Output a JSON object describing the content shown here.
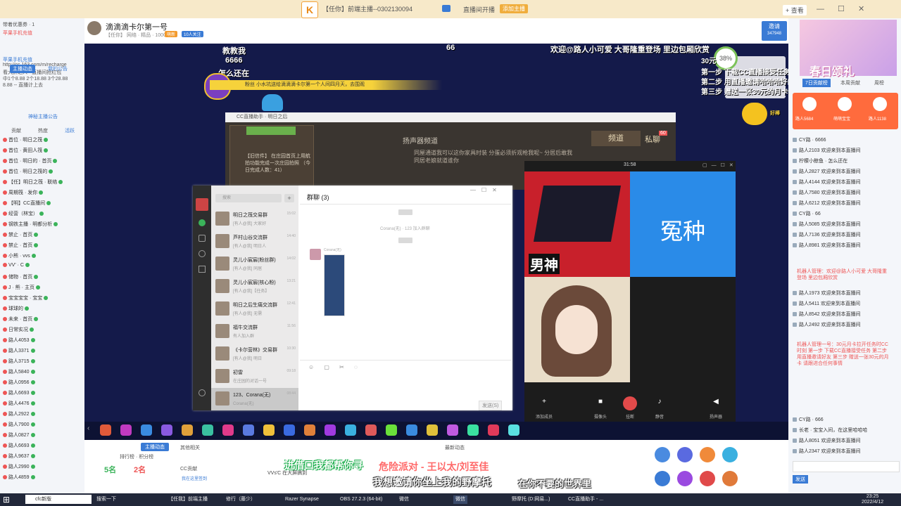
{
  "topbar": {
    "logo": "K",
    "title": "【任你】前端主播--0302130094",
    "live_label": "直播间开播",
    "add_button": "添加主播",
    "user_button": "+ 查看",
    "window_controls": "— ☐ ✕"
  },
  "left_panel": {
    "lines": [
      "带着优惠券 · 1",
      "苹果手机充值",
      "http://cc.163.com/m/recharge",
      "看大屏达人 · 直播间抢红包",
      "中1个8.88 2个18.88 3个28.88",
      "8.88 -- 直播计上去"
    ],
    "tabs": [
      "主播动态",
      "我的公告"
    ],
    "subtab": "神秘主播公告",
    "list_tabs": [
      "贡献",
      "热度",
      "活跃"
    ],
    "rows": [
      "首位 · 明日之筏",
      "首位 · 黄田人筏",
      "首位 · 明日的 · 首页",
      "首位 · 明日之筏的",
      "【任】明日之筏 · 联络",
      "周期筏 · 发你",
      "【明】CC直播间",
      "经营（林宝）",
      "钢铁主播 · 明都分析",
      "禁止 · 首页",
      "禁止 · 首页",
      "小熊 · vvs",
      "VV' · C",
      "储物 · 首页",
      "J · 熊 · 主页",
      "宝宝宝宝 · 宝宝",
      "球球的",
      "未来 · 首页",
      "日常实况",
      "路人4053",
      "路人3371",
      "路人3715",
      "路人5840",
      "路人0956",
      "路人6693",
      "路人4476",
      "路人2922",
      "路人7900",
      "路人0827",
      "路人6693",
      "路人9637",
      "路人2990",
      "路人4859"
    ]
  },
  "streamer": {
    "name": "滴滴滴卡尔第一号",
    "sub": "【任你】 网络 · 精品 · 1000人",
    "tag1": "萌新",
    "tag2": "10人关注",
    "share_label": "邀请",
    "share_count": "347948"
  },
  "overlay": {
    "left_lines": [
      "教教我",
      "6666",
      "怎么还在"
    ],
    "center_number": "66",
    "welcome": "欢迎@路人小可爱 大哥隆重登场 里边包厢欣赏",
    "banner": "粉丝  小水坑送给滴滴滴卡尔第一个人间四月天，去围观",
    "timer": "38%",
    "steps": [
      "30元",
      "第一步 下载CC直播接受任务",
      "第二步 用直播邀请哈哈哈好的",
      "第三步 赠送一张30元的月卡"
    ],
    "crown_label": "好棒",
    "gift_badge": "60"
  },
  "game": {
    "title": "CC直播助手 · 明日之后",
    "channel": "扬声器频道",
    "tab_channel": "频道",
    "tab_private": "私聊",
    "message": "同屋通道我可以这你家具时装 分蛋必须折观枪我呢~ 分居后敢我同居老娘就道谁你",
    "info": "【旧信件】 在庄园首页上用航拍功能完成一次庄园拍照 （今日完成人数：41）"
  },
  "wechat": {
    "search_placeholder": "搜索",
    "plus": "+",
    "chat_title": "群聊 (3)",
    "system_msg": "Corana(无) · 123 加入群聊",
    "sender": "Corana(无)",
    "tools": "☺ ▢ ✂ ◌",
    "send_label": "发送(S)",
    "contacts": [
      {
        "name": "明日之筏交易群",
        "preview": "[有人@我] 大家好",
        "time": "15:02"
      },
      {
        "name": "芦村山谷交流群",
        "preview": "[有人@我] 明日人",
        "time": "14:40"
      },
      {
        "name": "灵儿小宸宸(粉丝群)",
        "preview": "[有人@我] 同居",
        "time": "14:02"
      },
      {
        "name": "灵儿小宸宸(核心粉)",
        "preview": "[有人@我]【任务】",
        "time": "13:21"
      },
      {
        "name": "明日之后生痛交流群",
        "preview": "[有人@我] 无需",
        "time": "12:41"
      },
      {
        "name": "福牛交流群",
        "preview": "有人加入群",
        "time": "11:56"
      },
      {
        "name": "《卡尔营林》交易群",
        "preview": "[有人@我] 明日",
        "time": "10:30"
      },
      {
        "name": "初雷",
        "preview": "在庄园的对话一号",
        "time": "09:18"
      },
      {
        "name": "123、Corana(无)",
        "preview": "Corana(无)",
        "time": "08:44"
      }
    ]
  },
  "call": {
    "time": "31:58",
    "tile1_label": "男神",
    "tile2_label": "冤种",
    "buttons": [
      "添加成员",
      "摄像头",
      "挂断",
      "静音",
      "扬声器"
    ]
  },
  "below": {
    "tab_room": "主播动态",
    "tab_other": "其他相关",
    "tab_new": "最新动态",
    "rank": "排行榜 · 积分榜",
    "score_left": "5名",
    "score_right": "2名",
    "cc": "CC贡献",
    "sign": "我在这里签到",
    "lyric_line1": "进借口我都帮你寻",
    "lyric_song": "危险派对 - 王以太/刘至佳",
    "lyric_line2": "我想邀请你坐上我的野摩托",
    "lyric_line3": "在你不要的世界里",
    "chat_line": "VVs'C 在大屏搞到"
  },
  "right_panel": {
    "ad_text": "春日颂礼",
    "tabs": [
      "7日贡献榜",
      "本周贡献",
      "周榜"
    ],
    "fans": [
      "路人5684",
      "萌萌宝宝",
      "路人1138"
    ],
    "lines": [
      "CY路 · 6666",
      "路人2103 欢迎来到本直播间",
      "柠檬小鲸鱼 · 怎么还在",
      "路人2827 欢迎来到本直播间",
      "路人4144 欢迎来到本直播间",
      "路人7580 欢迎来到本直播间",
      "路人6212 欢迎来到本直播间",
      "CY路 · 66",
      "路人5085 欢迎来到本直播间",
      "路人7136 欢迎来到本直播间",
      "路人8981 欢迎来到本直播间"
    ],
    "robot1": "机器人管理：欢迎@路人小可爱 大哥隆重登场 里边包厢欣赏",
    "lines2": [
      "路人1973 欢迎来到本直播间",
      "路人5411 欢迎来到本直播间",
      "路人8542 欢迎来到本直播间",
      "路人2492 欢迎来到本直播间"
    ],
    "robot2": "机器人管理一号：30元月卡拉开任务时CC时刻 第一步 下载CC直播接受任务 第二步 用直播邀请好友 第三步 赠送一张30元的月卡 请跟进合任何事情",
    "lines3": [
      "CY路 · 666",
      "长老 · 宝宝入间，在这里哈哈哈",
      "路人8051 欢迎来到本直播间",
      "路人2347 欢迎来到本直播间"
    ],
    "send_label": "发送"
  },
  "taskbar": {
    "start": "⊞",
    "search": "cfc新版",
    "items": [
      "搜索一下",
      "【任我】前端主播",
      "修行（藤少）",
      "Razer Synapse",
      "OBS 27.2.3 (64-bit)",
      "微信",
      "微信",
      "野摩托 (D:网易...)",
      "CC直播助手 - ..."
    ],
    "time": "23:25",
    "date": "2022/4/12"
  },
  "colors": {
    "accent": "#3a7bd5",
    "highlight": "#f6d23b",
    "danger": "#e24a4a"
  }
}
